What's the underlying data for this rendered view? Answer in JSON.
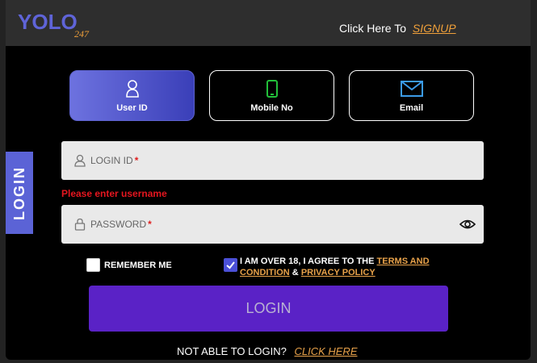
{
  "header": {
    "brand_text": "YOLO247",
    "signup_prompt": "Click Here To",
    "signup_link": "SIGNUP"
  },
  "side_tab": {
    "label": "LOGIN"
  },
  "tabs": [
    {
      "label": "User ID",
      "icon": "user-icon",
      "active": true
    },
    {
      "label": "Mobile No",
      "icon": "mobile-icon",
      "active": false
    },
    {
      "label": "Email",
      "icon": "email-icon",
      "active": false
    }
  ],
  "login_id": {
    "placeholder": "LOGIN ID",
    "required_mark": "*",
    "value": ""
  },
  "error": {
    "text": "Please enter username"
  },
  "password": {
    "placeholder": "PASSWORD",
    "required_mark": "*",
    "value": ""
  },
  "remember": {
    "label": "REMEMBER ME",
    "checked": false
  },
  "agree": {
    "text_line1": "I AM OVER 18, I AGREE TO THE",
    "terms_link_1": "TERMS AND",
    "terms_link_2": "CONDITION",
    "amp": "&",
    "privacy_link": "PRIVACY POLICY",
    "checked": true
  },
  "login_button": {
    "label": "LOGIN"
  },
  "footer": {
    "prompt": "NOT ABLE TO LOGIN?",
    "link": "CLICK HERE"
  },
  "colors": {
    "accent": "#5a22c6",
    "active_tab": "#5b63d6",
    "link": "#e8a24a",
    "error": "#e5161f"
  }
}
